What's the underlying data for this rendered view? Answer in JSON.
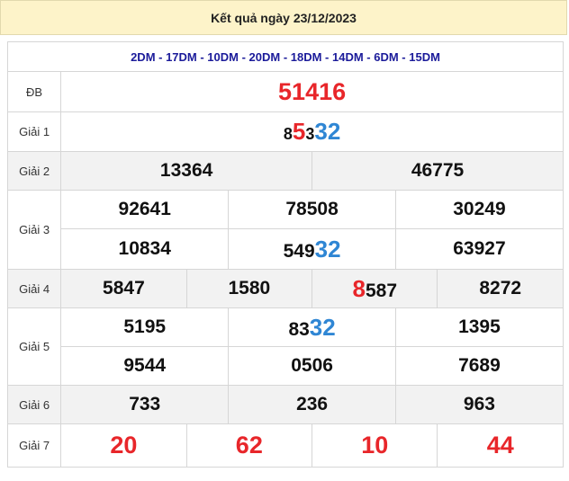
{
  "title": "Kết quả ngày 23/12/2023",
  "codes": "2DM - 17DM - 10DM - 20DM - 18DM - 14DM - 6DM - 15DM",
  "labels": {
    "db": "ĐB",
    "g1": "Giải 1",
    "g2": "Giải 2",
    "g3": "Giải 3",
    "g4": "Giải 4",
    "g5": "Giải 5",
    "g6": "Giải 6",
    "g7": "Giải 7"
  },
  "db": "51416",
  "g1": {
    "p1": "8",
    "p2": "5",
    "p3": "3",
    "p4": "32"
  },
  "g2": [
    "13364",
    "46775"
  ],
  "g3": [
    "92641",
    "78508",
    "30249",
    "10834",
    "549",
    "32",
    "63927"
  ],
  "g4": [
    "5847",
    "1580",
    "8",
    "587",
    "8272"
  ],
  "g5": [
    "5195",
    "83",
    "32",
    "1395",
    "9544",
    "0506",
    "7689"
  ],
  "g6": [
    "733",
    "236",
    "963"
  ],
  "g7": [
    "20",
    "62",
    "10",
    "44"
  ],
  "colors": {
    "red": "#e8262a",
    "blue": "#2f86d4",
    "navy": "#1b1b9a",
    "header_bg": "#fdf3c9"
  }
}
